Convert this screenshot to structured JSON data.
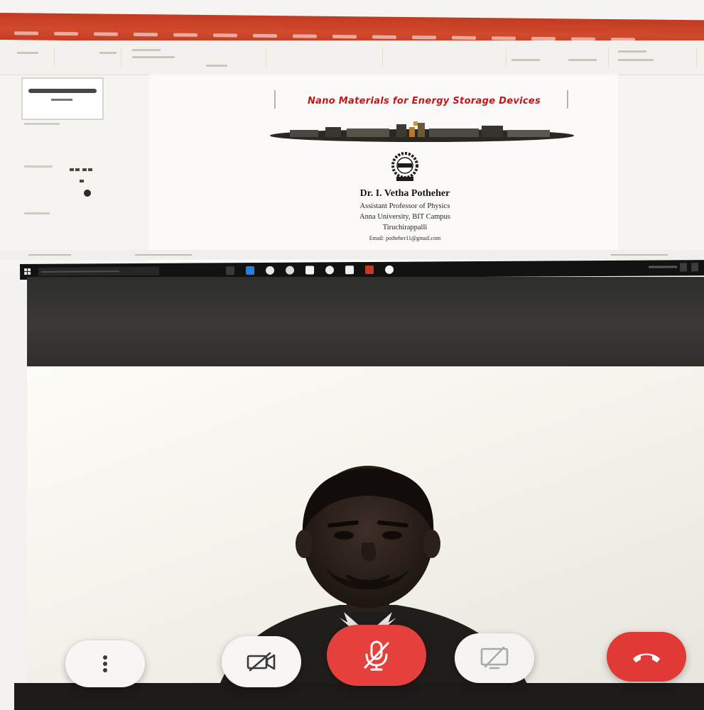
{
  "slide": {
    "title": "Nano Materials for Energy Storage Devices",
    "author": "Dr. I. Vetha Potheher",
    "designation": "Assistant Professor of Physics",
    "university": "Anna University, BIT Campus",
    "city": "Tiruchirappalli",
    "email": "Email: potheher11@gmail.com"
  },
  "icons": {
    "more": "more-vert-icon",
    "camera": "camera-off-icon",
    "mic": "mic-off-icon",
    "present": "present-screen-off-icon",
    "hangup": "call-end-icon",
    "windows_start": "windows-start-icon"
  },
  "colors": {
    "powerpoint_titlebar": "#c23a22",
    "slide_title": "#c3161b",
    "mute_button": "#e6403c",
    "hangup_button": "#e13a36",
    "taskbar": "#121212",
    "control_button": "#f7f6f4"
  }
}
